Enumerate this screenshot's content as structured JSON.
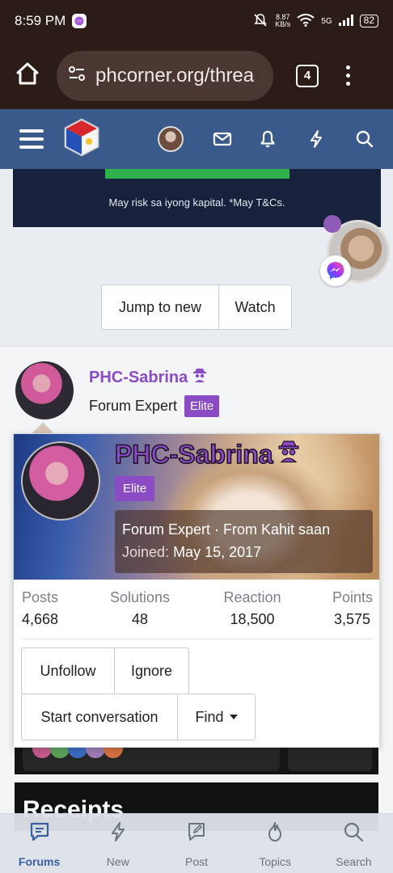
{
  "status_bar": {
    "time": "8:59 PM",
    "net_speed_value": "8.87",
    "net_speed_unit": "KB/s",
    "network": "5G",
    "battery": "82"
  },
  "browser": {
    "url": "phcorner.org/threa",
    "tab_count": "4"
  },
  "ad": {
    "text": "May risk sa iyong kapital. *May T&Cs."
  },
  "thread_actions": {
    "jump_label": "Jump to new",
    "watch_label": "Watch"
  },
  "poster": {
    "name": "PHC-Sabrina",
    "title": "Forum Expert",
    "badge": "Elite"
  },
  "member_card": {
    "name": "PHC-Sabrina",
    "badge": "Elite",
    "tagline": "Forum Expert · From Kahit saan",
    "joined_label": "Joined:",
    "joined_date": "May 15, 2017",
    "stats": [
      {
        "label": "Posts",
        "value": "4,668"
      },
      {
        "label": "Solutions",
        "value": "48"
      },
      {
        "label": "Reaction",
        "value": "18,500"
      },
      {
        "label": "Points",
        "value": "3,575"
      }
    ],
    "buttons": {
      "unfollow": "Unfollow",
      "ignore": "Ignore",
      "start_conversation": "Start conversation",
      "find": "Find"
    }
  },
  "section": {
    "receipts_title": "Receipts"
  },
  "bottom_nav": [
    {
      "label": "Forums",
      "icon": "forums-icon",
      "active": true
    },
    {
      "label": "New",
      "icon": "new-icon",
      "active": false
    },
    {
      "label": "Post",
      "icon": "post-icon",
      "active": false
    },
    {
      "label": "Topics",
      "icon": "topics-icon",
      "active": false
    },
    {
      "label": "Search",
      "icon": "search-icon",
      "active": false
    }
  ],
  "colors": {
    "header": "#3a5a8c",
    "accent_purple": "#8a4bc4",
    "active_nav": "#3b5ea0"
  }
}
